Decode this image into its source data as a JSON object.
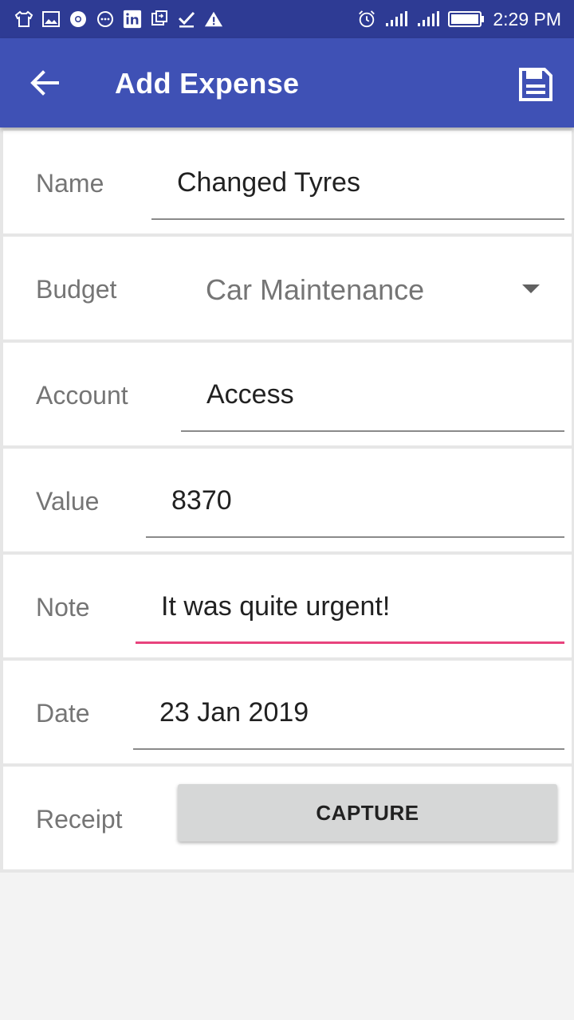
{
  "status_bar": {
    "time": "2:29 PM",
    "left_icons": [
      "shirt-icon",
      "image-icon",
      "chrome-icon",
      "chat-bubble-icon",
      "linkedin-icon",
      "sync-icon",
      "check-icon",
      "warning-icon"
    ],
    "right_icons": [
      "alarm-icon",
      "signal-icon",
      "signal-icon",
      "battery-icon"
    ]
  },
  "app_bar": {
    "title": "Add Expense",
    "back_icon": "arrow-back-icon",
    "save_icon": "save-icon",
    "color": "#3f51b5",
    "status_color": "#2e3b94"
  },
  "form": {
    "name": {
      "label": "Name",
      "value": "Changed Tyres"
    },
    "budget": {
      "label": "Budget",
      "value": "Car Maintenance"
    },
    "account": {
      "label": "Account",
      "value": "Access"
    },
    "value": {
      "label": "Value",
      "value": "8370"
    },
    "note": {
      "label": "Note",
      "value": "It was quite urgent!"
    },
    "date": {
      "label": "Date",
      "value": "23 Jan 2019"
    },
    "receipt": {
      "label": "Receipt",
      "button_label": "CAPTURE"
    }
  },
  "accent_color": "#e8437d"
}
